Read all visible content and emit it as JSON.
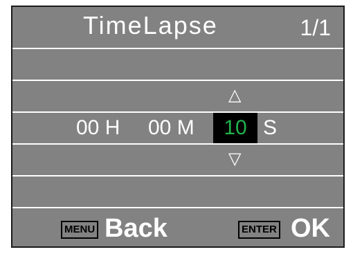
{
  "header": {
    "title": "TimeLapse",
    "page": "1/1"
  },
  "timer": {
    "hours_value": "00",
    "hours_unit": "H",
    "minutes_value": "00",
    "minutes_unit": "M",
    "seconds_value": "10",
    "seconds_unit": "S"
  },
  "arrows": {
    "up": "△",
    "down": "▽"
  },
  "footer": {
    "menu_key": "MENU",
    "back_label": "Back",
    "enter_key": "ENTER",
    "ok_label": "OK"
  },
  "colors": {
    "screen_bg": "#828282",
    "selected_bg": "#000000",
    "selected_text": "#22b24c"
  }
}
